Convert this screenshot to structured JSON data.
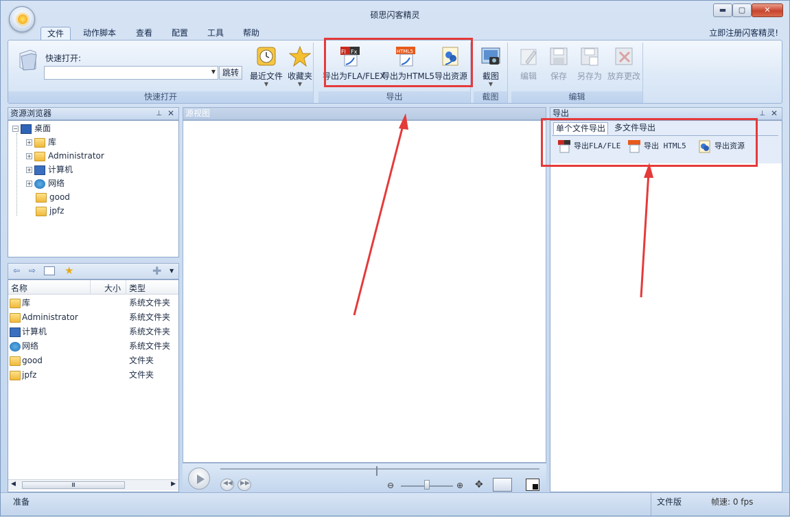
{
  "window": {
    "title": "硕思闪客精灵",
    "min": "▬",
    "max": "▢",
    "close": "✕"
  },
  "menu": {
    "tabs": [
      "文件",
      "动作脚本",
      "查看",
      "配置",
      "工具",
      "帮助"
    ],
    "active_tab": "文件",
    "register": "立即注册闪客精灵!"
  },
  "ribbon": {
    "quick_open": {
      "label": "快速打开:",
      "input_value": "",
      "go_button": "跳转",
      "recent": "最近文件",
      "favorites": "收藏夹",
      "group_label": "快速打开"
    },
    "export": {
      "fla": "导出为FLA/FLEX",
      "html5": "导出为HTML5",
      "resources": "导出资源",
      "group_label": "导出"
    },
    "screenshot": {
      "label": "截图",
      "group_label": "截图"
    },
    "edit": {
      "edit": "编辑",
      "save": "保存",
      "save_as": "另存为",
      "discard": "放弃更改",
      "group_label": "编辑"
    }
  },
  "resource_browser": {
    "title": "资源浏览器",
    "tree": [
      {
        "label": "桌面",
        "icon": "desktop-icon"
      },
      {
        "label": "库",
        "icon": "library-icon"
      },
      {
        "label": "Administrator",
        "icon": "user-folder-icon"
      },
      {
        "label": "计算机",
        "icon": "computer-icon"
      },
      {
        "label": "网络",
        "icon": "network-icon"
      },
      {
        "label": "good",
        "icon": "folder-icon"
      },
      {
        "label": "jpfz",
        "icon": "folder-icon"
      }
    ]
  },
  "file_list": {
    "columns": {
      "name": "名称",
      "size": "大小",
      "type": "类型"
    },
    "rows": [
      {
        "name": "库",
        "type": "系统文件夹",
        "icon": "library-icon"
      },
      {
        "name": "Administrator",
        "type": "系统文件夹",
        "icon": "user-folder-icon"
      },
      {
        "name": "计算机",
        "type": "系统文件夹",
        "icon": "computer-icon"
      },
      {
        "name": "网络",
        "type": "系统文件夹",
        "icon": "network-icon"
      },
      {
        "name": "good",
        "type": "文件夹",
        "icon": "folder-icon"
      },
      {
        "name": "jpfz",
        "type": "文件夹",
        "icon": "folder-icon"
      }
    ],
    "scroll_thumb": "Ⅲ"
  },
  "source_view": {
    "title": "源视图"
  },
  "export_panel": {
    "title": "导出",
    "tabs": [
      "单个文件导出",
      "多文件导出"
    ],
    "buttons": [
      "导出FLA/FLE",
      "导出 HTML5",
      "导出资源"
    ]
  },
  "status": {
    "left": "准备",
    "file_label": "文件版",
    "fps": "帧速: 0 fps"
  },
  "colors": {
    "highlight_box": "#e53a3a",
    "arrow": "#e53a3a"
  }
}
